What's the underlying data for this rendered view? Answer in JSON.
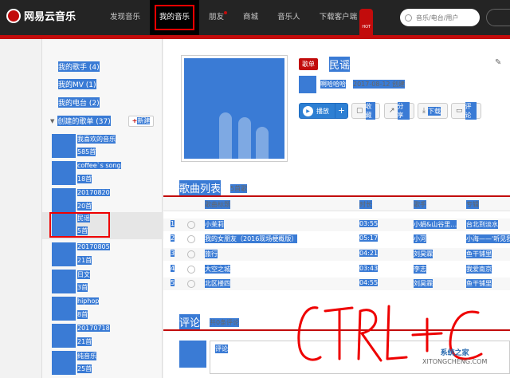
{
  "app": {
    "logo_text": "网易云音乐"
  },
  "nav": [
    {
      "label": "发现音乐",
      "active": false
    },
    {
      "label": "我的音乐",
      "active": true
    },
    {
      "label": "朋友",
      "dot": true
    },
    {
      "label": "商城"
    },
    {
      "label": "音乐人"
    },
    {
      "label": "下载客户端",
      "badge": "HOT"
    }
  ],
  "search": {
    "placeholder": "音乐/电台/用户"
  },
  "sidebar": {
    "links": [
      "我的歌手 (4)",
      "我的MV (1)",
      "我的电台 (2)"
    ],
    "created_header": "创建的歌单 (37)",
    "new_button": "新建",
    "playlists": [
      {
        "title": "我喜欢的音乐",
        "count": "585首"
      },
      {
        "title": "coffee`s song",
        "count": "18首"
      },
      {
        "title": "20170820",
        "count": "20首"
      },
      {
        "title": "民谣",
        "count": "5首",
        "selected": true
      },
      {
        "title": "20170805",
        "count": "21首"
      },
      {
        "title": "日文",
        "count": "3首"
      },
      {
        "title": "hiphop",
        "count": "8首"
      },
      {
        "title": "20170718",
        "count": "21首"
      },
      {
        "title": "纯音乐",
        "count": "25首"
      }
    ]
  },
  "playlist": {
    "badge": "歌单",
    "title": "民谣",
    "creator": "啊哈哈哈",
    "created": "2017-08-12 创建",
    "actions": [
      "播放",
      "+",
      "收藏",
      "分享",
      "下载",
      "评论"
    ]
  },
  "songs": {
    "heading": "歌曲列表",
    "count_label": "5首歌",
    "columns": [
      "歌曲标题",
      "时长",
      "歌手",
      "专辑"
    ],
    "rows": [
      {
        "no": "1",
        "title": "小茉莉",
        "duration": "03:55",
        "artist": "小娟&山谷里…",
        "album": "台北到淡水"
      },
      {
        "no": "2",
        "title": "我的女朋友（2016现场梗概版）",
        "duration": "05:17",
        "artist": "小河",
        "album": "小海——'听见我…"
      },
      {
        "no": "3",
        "title": "旅行",
        "duration": "04:21",
        "artist": "刘昊霖",
        "album": "鱼干铺里"
      },
      {
        "no": "4",
        "title": "大空之城",
        "duration": "03:43",
        "artist": "李志",
        "album": "我爱南京"
      },
      {
        "no": "5",
        "title": "北区楼四",
        "duration": "04:55",
        "artist": "刘昊霖",
        "album": "鱼干铺里"
      }
    ]
  },
  "comments": {
    "heading": "评论",
    "count_label": "共0条评论",
    "input_label": "评论"
  },
  "annotation": "CTRL+C",
  "watermark": {
    "line1": "系统之家",
    "line2": "XITONGCHENG.COM"
  },
  "colors": {
    "brand": "#c20c0c",
    "highlight": "#3a7bd5"
  }
}
